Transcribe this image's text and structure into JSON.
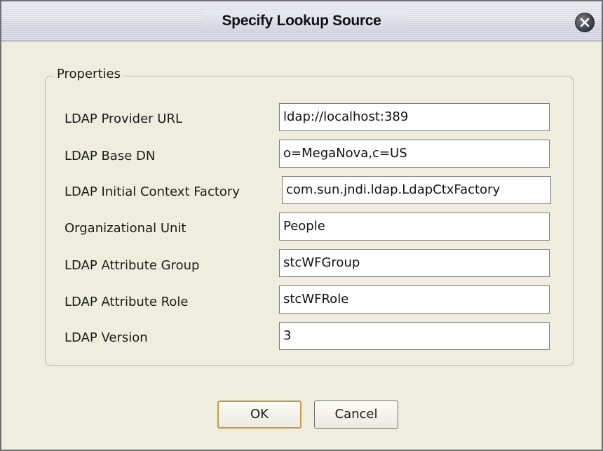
{
  "dialog": {
    "title": "Specify Lookup Source",
    "close_icon": "close-icon"
  },
  "properties": {
    "legend": "Properties",
    "rows": [
      {
        "label": "LDAP Provider URL",
        "value": "ldap://localhost:389"
      },
      {
        "label": "LDAP Base DN",
        "value": "o=MegaNova,c=US"
      },
      {
        "label": "LDAP Initial Context Factory",
        "value": "com.sun.jndi.ldap.LdapCtxFactory"
      },
      {
        "label": "Organizational Unit",
        "value": "People"
      },
      {
        "label": "LDAP Attribute Group",
        "value": "stcWFGroup"
      },
      {
        "label": "LDAP Attribute Role",
        "value": "stcWFRole"
      },
      {
        "label": "LDAP Version",
        "value": "3"
      }
    ]
  },
  "buttons": {
    "ok_label": "OK",
    "cancel_label": "Cancel"
  },
  "colors": {
    "dialog_background": "#efeede",
    "default_button_border": "#c89a48"
  }
}
